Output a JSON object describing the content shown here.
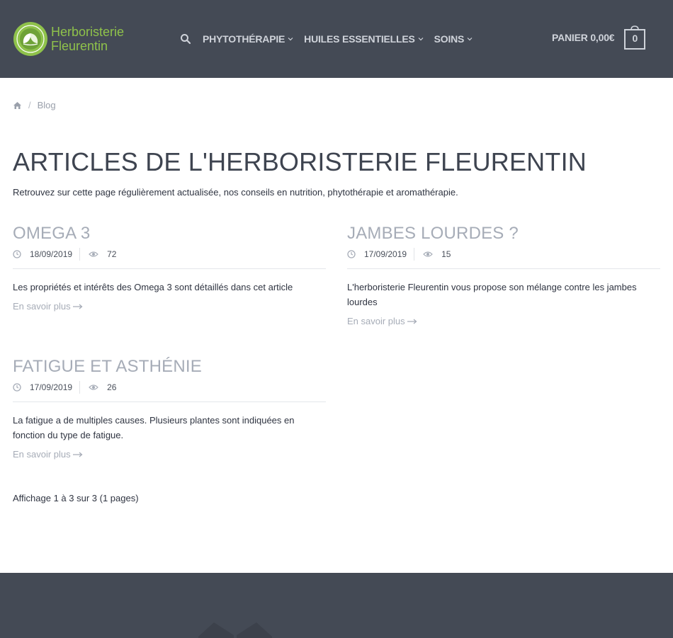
{
  "header": {
    "logo_line1": "Herboristerie",
    "logo_line2": "Fleurentin",
    "nav": [
      {
        "label": "PHYTOTHÉRAPIE"
      },
      {
        "label": "HUILES ESSENTIELLES"
      },
      {
        "label": "SOINS"
      }
    ],
    "cart_label": "PANIER 0,00€",
    "cart_count": "0"
  },
  "breadcrumb": {
    "current": "Blog"
  },
  "page": {
    "title": "ARTICLES DE L'HERBORISTERIE FLEURENTIN",
    "intro": "Retrouvez sur cette page régulièrement actualisée, nos conseils en nutrition, phytothérapie et aromathérapie."
  },
  "articles": [
    {
      "title": "OMEGA 3",
      "date": "18/09/2019",
      "views": "72",
      "excerpt": "Les propriétés et intérêts des Omega 3 sont détaillés dans cet article",
      "more": "En savoir plus"
    },
    {
      "title": "JAMBES LOURDES ?",
      "date": "17/09/2019",
      "views": "15",
      "excerpt": "L'herboristerie Fleurentin vous propose son mélange contre les jambes lourdes",
      "more": "En savoir plus"
    },
    {
      "title": "FATIGUE ET ASTHÉNIE",
      "date": "17/09/2019",
      "views": "26",
      "excerpt": "La fatigue a de multiples causes. Plusieurs plantes sont indiquées en fonction du type de fatigue.",
      "more": "En savoir plus"
    }
  ],
  "pagination": {
    "info": "Affichage 1 à 3 sur 3 (1 pages)"
  },
  "colors": {
    "header_bg": "#444a55",
    "brand_green": "#8fc24b",
    "muted_title": "#a6acb7"
  }
}
